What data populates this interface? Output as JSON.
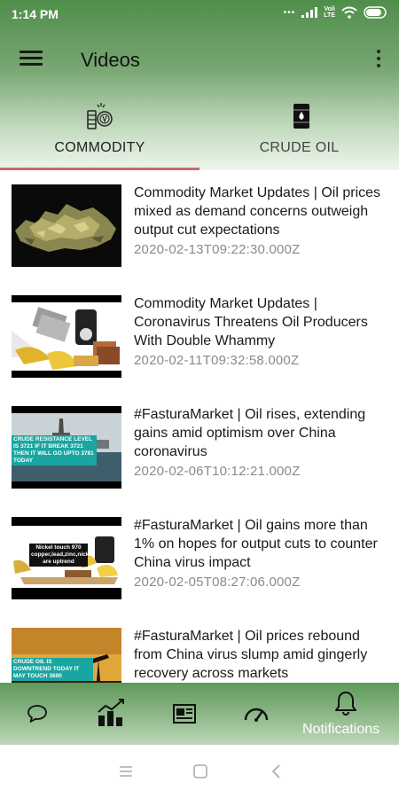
{
  "status_bar": {
    "time": "1:14 PM",
    "network_badge_top": "Voli",
    "network_badge_bottom": "LTE",
    "battery_percent": 85
  },
  "toolbar": {
    "title": "Videos",
    "menu_icon": "hamburger-menu-icon",
    "overflow_icon": "more-vertical-icon"
  },
  "tabs": [
    {
      "label": "COMMODITY",
      "icon": "commodity-coins-icon",
      "selected": true
    },
    {
      "label": "CRUDE OIL",
      "icon": "oil-barrel-icon",
      "selected": false
    }
  ],
  "feed": {
    "items": [
      {
        "title": "Commodity Market Updates | Oil prices mixed as demand concerns outweigh output cut expectations",
        "date": "2020-02-13T09:22:30.000Z",
        "thumbnail": "gold-ore-rocks"
      },
      {
        "title": "Commodity Market Updates | Coronavirus Threatens Oil Producers With Double Whammy",
        "date": "2020-02-11T09:32:58.000Z",
        "thumbnail": "commodities-collage"
      },
      {
        "title": "#FasturaMarket | Oil rises, extending gains amid optimism over China coronavirus",
        "date": "2020-02-06T10:12:21.000Z",
        "thumbnail": "oil-rig",
        "overlay_text": "CRUDE RESISTANCE LEVEL IS 3721 IF IT BREAK 3721 THEN IT WILL GO UPTO 3781 TODAY"
      },
      {
        "title": "#FasturaMarket | Oil gains more than 1% on hopes for output cuts to counter China virus impact",
        "date": "2020-02-05T08:27:06.000Z",
        "thumbnail": "commodities-banner",
        "overlay_text": "Nickel touch 970 copper,lead,zinc,nickel are uptrend"
      },
      {
        "title": "#FasturaMarket | Oil prices rebound from China virus slump amid gingerly recovery across markets",
        "date": "",
        "thumbnail": "oil-pumps-sunset",
        "overlay_text": "CRUDE OIL IS DOWNTREND TODAY IT MAY TOUCH 3600"
      }
    ]
  },
  "bottom_nav": {
    "items": [
      {
        "icon": "chat-bubble-icon",
        "label": ""
      },
      {
        "icon": "bar-chart-icon",
        "label": ""
      },
      {
        "icon": "newspaper-icon",
        "label": ""
      },
      {
        "icon": "speedometer-icon",
        "label": ""
      },
      {
        "icon": "bell-icon",
        "label": "Notifications"
      }
    ]
  },
  "system_nav": [
    "recents-icon",
    "home-icon",
    "back-icon"
  ],
  "colors": {
    "header_green": "#4f8e4a",
    "tab_indicator": "#c9696a",
    "date_gray": "#8a8a8a"
  }
}
